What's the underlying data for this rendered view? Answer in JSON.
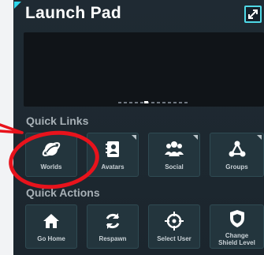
{
  "window": {
    "title": "Launch Pad",
    "accent": "#30d9ee",
    "expand_icon": "expand-icon"
  },
  "quick_links": {
    "heading": "Quick Links",
    "items": [
      {
        "label": "Worlds",
        "icon": "planet-icon"
      },
      {
        "label": "Avatars",
        "icon": "avatar-book-icon"
      },
      {
        "label": "Social",
        "icon": "people-icon"
      },
      {
        "label": "Groups",
        "icon": "group-nodes-icon"
      }
    ]
  },
  "quick_actions": {
    "heading": "Quick Actions",
    "items": [
      {
        "label": "Go Home",
        "icon": "home-icon"
      },
      {
        "label": "Respawn",
        "icon": "respawn-icon"
      },
      {
        "label": "Select User",
        "icon": "crosshair-icon"
      },
      {
        "label_line1": "Change",
        "label_line2": "Shield Level",
        "icon": "shield-icon"
      }
    ]
  },
  "annotation": {
    "color": "#e8131c"
  }
}
